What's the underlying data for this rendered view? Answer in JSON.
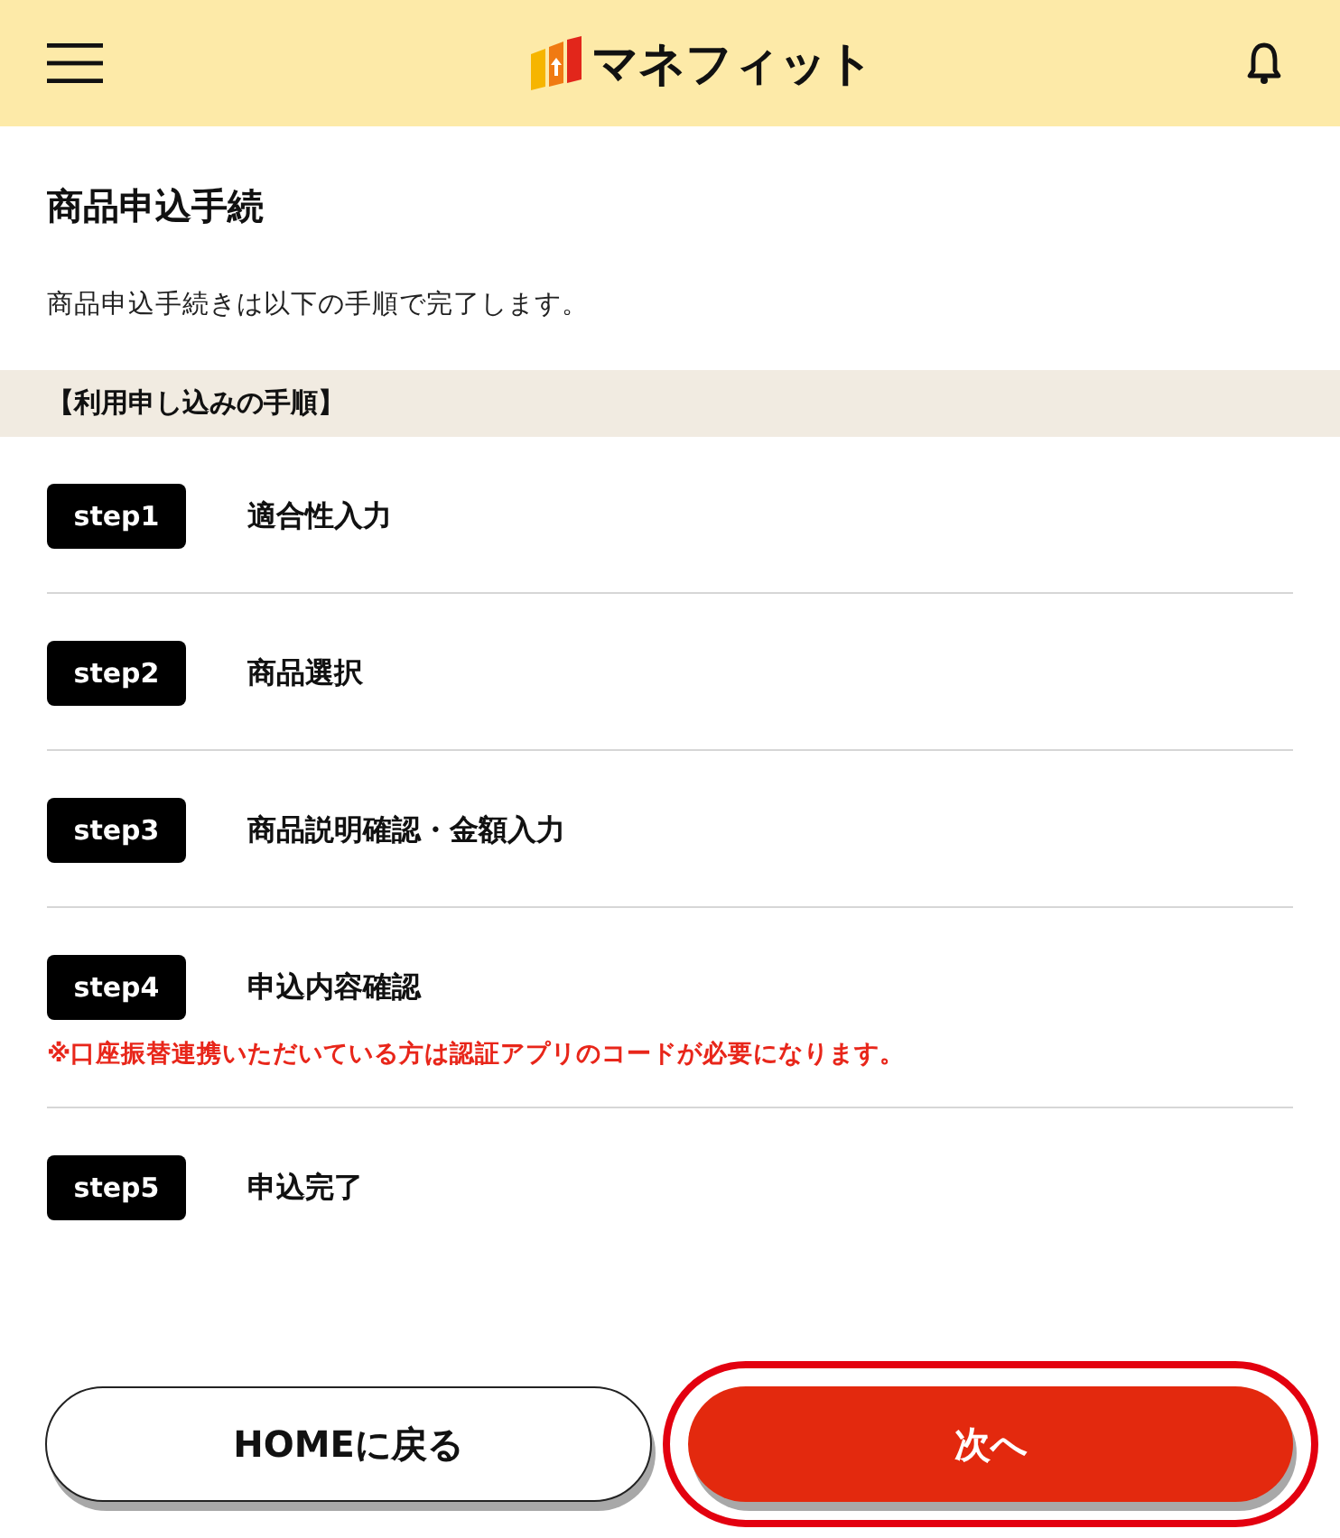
{
  "header": {
    "logo_text": "マネフィット"
  },
  "title": "商品申込手続",
  "description": "商品申込手続きは以下の手順で完了します。",
  "section_heading": "【利用申し込みの手順】",
  "steps": [
    {
      "badge": "step1",
      "label": "適合性入力"
    },
    {
      "badge": "step2",
      "label": "商品選択"
    },
    {
      "badge": "step3",
      "label": "商品説明確認・金額入力"
    },
    {
      "badge": "step4",
      "label": "申込内容確認",
      "note": "※口座振替連携いただいている方は認証アプリのコードが必要になります。"
    },
    {
      "badge": "step5",
      "label": "申込完了"
    }
  ],
  "buttons": [
    {
      "label": "HOMEに戻る",
      "kind": "secondary",
      "highlighted": false
    },
    {
      "label": "次へ",
      "kind": "primary",
      "highlighted": true
    }
  ]
}
